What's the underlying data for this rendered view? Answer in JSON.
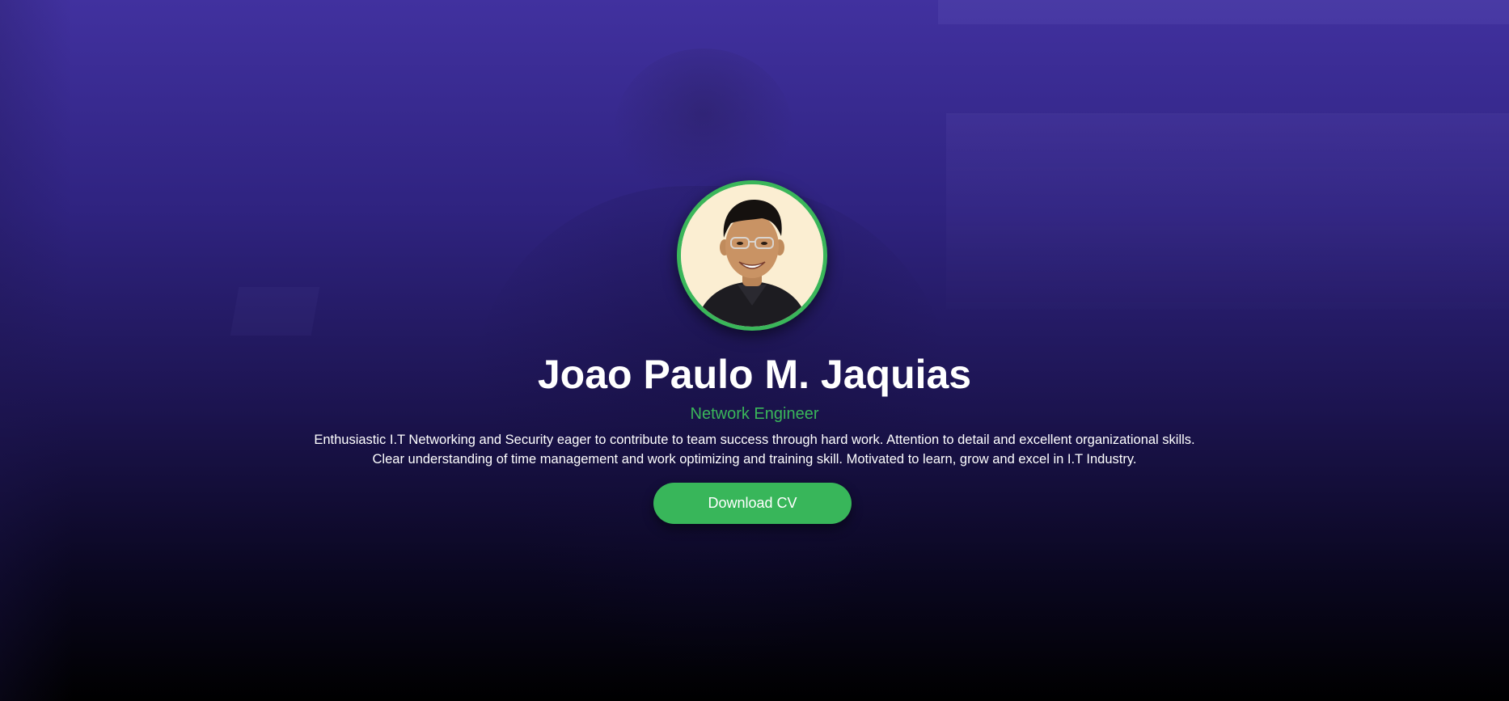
{
  "profile": {
    "name": "Joao Paulo M. Jaquias",
    "title": "Network Engineer",
    "bio": "Enthusiastic I.T Networking and Security eager to contribute to team success through hard work. Attention to detail and excellent organizational skills. Clear understanding of time management and work optimizing and training skill. Motivated to learn, grow and excel in I.T Industry.",
    "avatar_icon": "profile-photo",
    "cta_label": "Download CV"
  },
  "colors": {
    "accent": "#3ab65a",
    "gradient_top": "#41319f",
    "gradient_bottom": "#000000",
    "text": "#ffffff"
  }
}
